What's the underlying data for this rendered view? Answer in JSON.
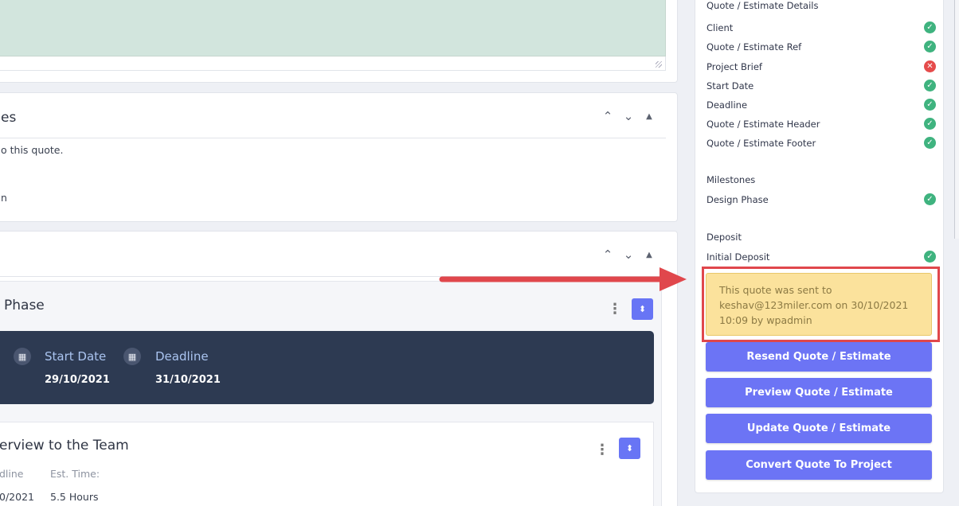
{
  "terms": {
    "title": "es",
    "line1": "o this quote.",
    "line2": "n"
  },
  "milestone": {
    "phase_title": "Phase",
    "start_label": "Start Date",
    "start_value": "29/10/2021",
    "deadline_label": "Deadline",
    "deadline_value": "31/10/2021",
    "task_title": "erview to the Team",
    "task_deadline_label": "dline",
    "task_deadline_value": "0/2021",
    "task_est_label": "Est. Time:",
    "task_est_value": "5.5 Hours"
  },
  "sidebar": {
    "details_heading": "Quote / Estimate Details",
    "details": [
      {
        "label": "Client",
        "status": "ok"
      },
      {
        "label": "Quote / Estimate Ref",
        "status": "ok"
      },
      {
        "label": "Project Brief",
        "status": "bad"
      },
      {
        "label": "Start Date",
        "status": "ok"
      },
      {
        "label": "Deadline",
        "status": "ok"
      },
      {
        "label": "Quote / Estimate Header",
        "status": "ok"
      },
      {
        "label": "Quote / Estimate Footer",
        "status": "ok"
      }
    ],
    "milestones_heading": "Milestones",
    "milestones": [
      {
        "label": "Design Phase",
        "status": "ok"
      }
    ],
    "deposit_heading": "Deposit",
    "deposits": [
      {
        "label": "Initial Deposit",
        "status": "ok"
      }
    ],
    "notice": "This quote was sent to keshav@123miler.com on 30/10/2021 10:09 by wpadmin",
    "buttons": {
      "resend": "Resend Quote / Estimate",
      "preview": "Preview Quote / Estimate",
      "update": "Update Quote / Estimate",
      "convert": "Convert Quote To Project"
    }
  },
  "colors": {
    "accent": "#6c74f5",
    "ok": "#3fb37f",
    "bad": "#e54b4b",
    "annotation": "#e0474c"
  }
}
